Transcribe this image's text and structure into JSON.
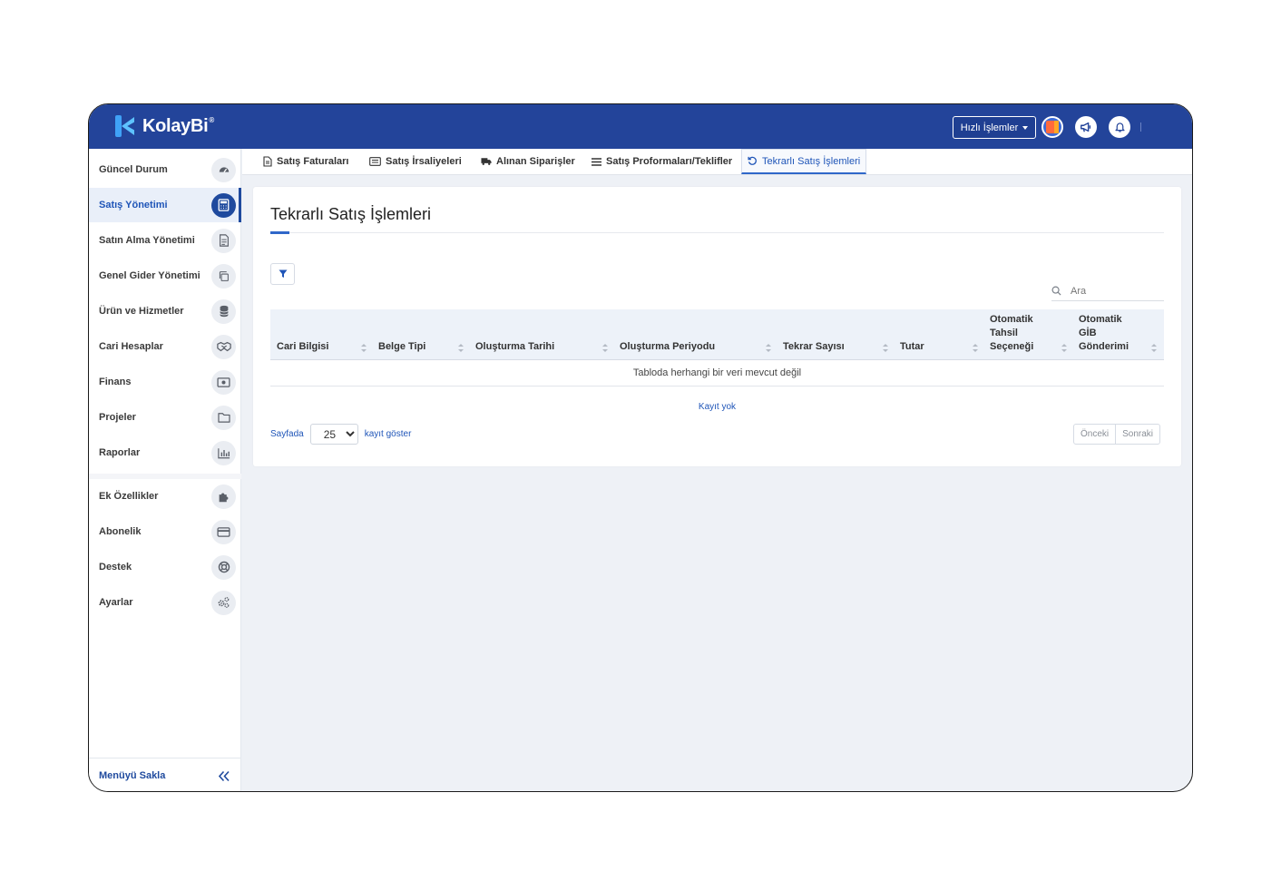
{
  "app": {
    "brand": "KolayBi",
    "brand_mark": "®"
  },
  "topbar": {
    "quick_actions_label": "Hızlı İşlemler"
  },
  "sidebar": {
    "items": [
      {
        "label": "Güncel Durum"
      },
      {
        "label": "Satış Yönetimi"
      },
      {
        "label": "Satın Alma Yönetimi"
      },
      {
        "label": "Genel Gider Yönetimi"
      },
      {
        "label": "Ürün ve Hizmetler"
      },
      {
        "label": "Cari Hesaplar"
      },
      {
        "label": "Finans"
      },
      {
        "label": "Projeler"
      },
      {
        "label": "Raporlar"
      },
      {
        "label": "Ek Özellikler"
      },
      {
        "label": "Abonelik"
      },
      {
        "label": "Destek"
      },
      {
        "label": "Ayarlar"
      }
    ],
    "active_index": 1,
    "hide_menu_label": "Menüyü Sakla"
  },
  "tabs": [
    {
      "label": "Satış Faturaları"
    },
    {
      "label": "Satış İrsaliyeleri"
    },
    {
      "label": "Alınan Siparişler"
    },
    {
      "label": "Satış Proformaları/Teklifler"
    },
    {
      "label": "Tekrarlı Satış İşlemleri"
    }
  ],
  "page": {
    "title": "Tekrarlı Satış İşlemleri",
    "search_placeholder": "Ara",
    "table": {
      "columns": [
        "Cari Bilgisi",
        "Belge Tipi",
        "Oluşturma Tarihi",
        "Oluşturma Periyodu",
        "Tekrar Sayısı",
        "Tutar",
        "Otomatik Tahsil Seçeneği",
        "Otomatik GİB Gönderimi"
      ],
      "empty_message": "Tabloda herhangi bir veri mevcut değil"
    },
    "no_records": "Kayıt yok",
    "per_page_prefix": "Sayfada",
    "per_page_value": "25",
    "per_page_suffix": "kayıt göster",
    "pager": {
      "prev": "Önceki",
      "next": "Sonraki"
    }
  },
  "colors": {
    "topbar": "#23449a",
    "accent": "#1f55b8",
    "background": "#eef1f6"
  }
}
